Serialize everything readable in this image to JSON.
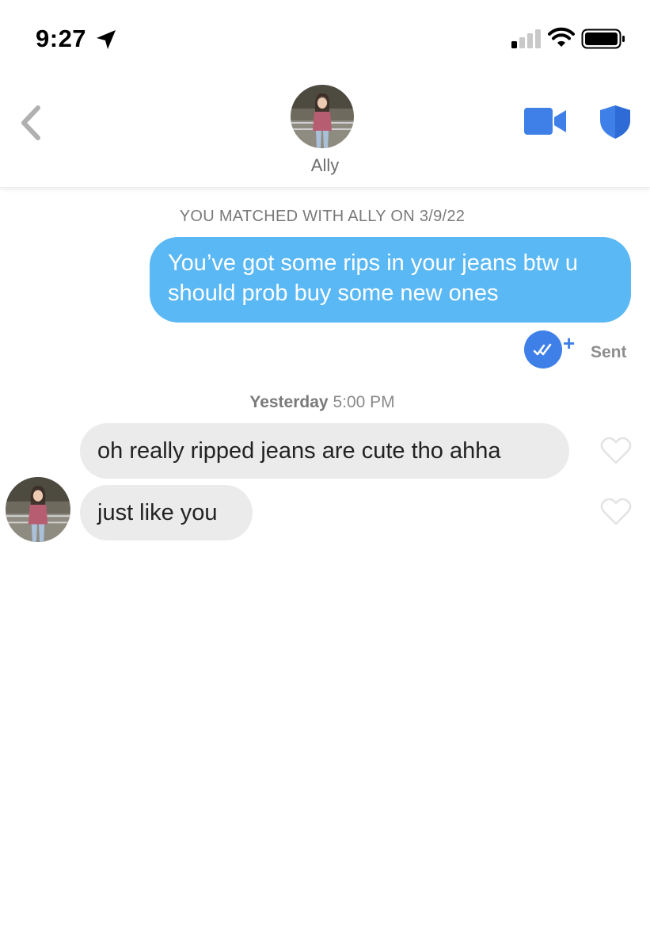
{
  "status_bar": {
    "time": "9:27"
  },
  "header": {
    "contact_name": "Ally",
    "accent_color": "#3f7fe8"
  },
  "chat": {
    "match_banner": "YOU MATCHED WITH ALLY ON 3/9/22",
    "outgoing": {
      "text": "You’ve got some rips in your jeans btw u should prob buy some new ones",
      "status": "Sent",
      "bubble_color": "#5ab8f5"
    },
    "timestamp": {
      "day": "Yesterday",
      "time": "5:00 PM"
    },
    "incoming": [
      {
        "text": "oh really ripped jeans are cute tho ahha"
      },
      {
        "text": "just like you"
      }
    ]
  },
  "icons": [
    "location-arrow-icon",
    "signal-icon",
    "wifi-icon",
    "battery-icon",
    "back-chevron-icon",
    "video-camera-icon",
    "shield-icon",
    "double-check-icon",
    "plus-icon",
    "heart-icon"
  ]
}
